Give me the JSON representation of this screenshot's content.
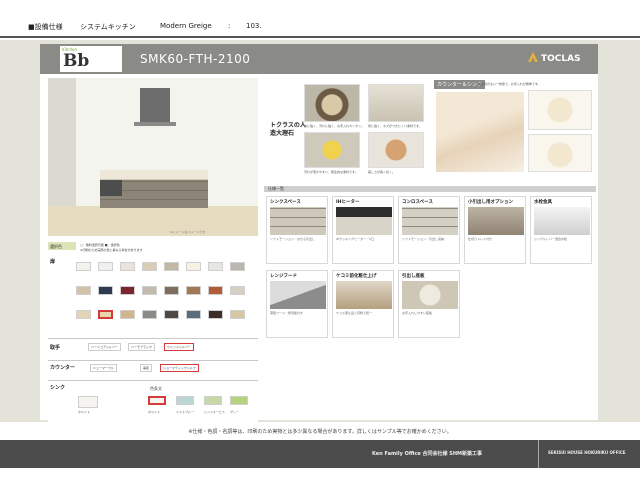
{
  "topbar": {
    "section": "■設備仕様",
    "category": "システムキッチン",
    "style": "Modern Greige",
    "colon": ":",
    "number": "103."
  },
  "header": {
    "logo_sub": "Kitchen",
    "logo": "Bb",
    "model": "SMK60-FTH-2100",
    "brand": "TOCLAS"
  },
  "render": {
    "caption": "※イメージはイメージです"
  },
  "selection": {
    "heading": "選択色",
    "notes": [
      "□：無料選択可能 ■：選択色",
      "※印刷のため実際の色と異なる場合があります"
    ],
    "rows": {
      "door": "扉",
      "handle": "取手",
      "counter": "カウンター",
      "sink": "シンク"
    },
    "handle_chips": [
      "ハードコアシルバー",
      "ハーモブラック",
      "ウインドシルバー"
    ],
    "counter_chips": [
      "ニューマーブル",
      "美肌",
      "ショーマティックシルク"
    ],
    "sink_label": "色条文",
    "sink_chips": [
      "ホワイト",
      "ミストブルー",
      "シンフォーピス",
      "グレー"
    ],
    "sink_side": "ホワイト"
  },
  "features": {
    "title": "トクラスの人造大理石",
    "counter_sink_title": "カウンター＆シンク",
    "counter_sink_desc": "継ぎ目がない一体型で、お手入れが簡単です。",
    "captions": [
      "熱に強く、汚れに強く、お手入れカンタン。",
      "傷に強く、キズがつきにくい素材です。",
      "汚れが落ちやすい、衛生的な素材です。",
      "美しさが長く続く。"
    ]
  },
  "spec": {
    "bar": "仕様一覧",
    "cards": [
      {
        "title": "シンクスペース",
        "desc": "ソフトモーション／おちる引出し"
      },
      {
        "title": "IHヒーター",
        "desc": "IHクッキングヒーター／3口"
      },
      {
        "title": "コンロスペース",
        "desc": "ソフトモーション／引出し収納"
      },
      {
        "title": "小引出し用オプション",
        "desc": "仕切りトレイ付き"
      },
      {
        "title": "水栓金具",
        "desc": "シングルレバー混合水栓"
      },
      {
        "title": "レンジフード",
        "desc": "薄型フード／整流板付き"
      },
      {
        "title": "ケコミ前化粧仕上げ",
        "desc": "ケコミ部も扉と同柄で統一"
      },
      {
        "title": "引出し底板",
        "desc": "お手入れしやすい底板"
      }
    ]
  },
  "swatch_colors": [
    "#f4f2ec",
    "#efefef",
    "#e9e4da",
    "#d9cdb9",
    "#c2b8a4",
    "#f6f1e2",
    "#e7e6e1",
    "#b9b7b0",
    "#d3c3a6",
    "#2e3a4f",
    "#7b2432",
    "#c4bbb0",
    "#7d6e5e",
    "#a07a55",
    "#b25c3a",
    "#d8cfc4",
    "#e1d5b5",
    "#e7d7a9",
    "#d2b48c",
    "#8b8a84",
    "#4f4943",
    "#5a6d7a",
    "#3b2e27",
    "#d7c7a5"
  ],
  "bottom_note": "※仕様・色調・名調等は、印刷のため実物とは多少異なる場合があります。詳しくはサンプル等でお確かめください。",
  "footer": {
    "company": "Ken Family Office 合同会社様 SHM新築工事",
    "office": "SEKISUI HOUSE HOKURIKU OFFICE"
  }
}
